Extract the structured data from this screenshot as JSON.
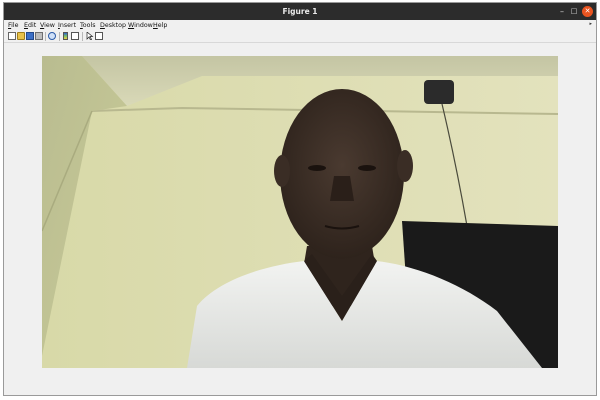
{
  "window": {
    "title": "Figure 1",
    "controls": {
      "minimize": "–",
      "maximize": "□",
      "close": "✕"
    }
  },
  "menubar": {
    "items": [
      "File",
      "Edit",
      "View",
      "Insert",
      "Tools",
      "Desktop",
      "Window",
      "Help"
    ],
    "overflow_arrow": "▸"
  },
  "toolbar": {
    "icons": [
      "new-figure-icon",
      "open-file-icon",
      "save-icon",
      "print-icon",
      "zoom-icon",
      "insert-colorbar-icon",
      "insert-legend-icon",
      "edit-plot-pointer-icon",
      "dock-figure-icon"
    ]
  },
  "figure": {
    "image_description_icon": "webcam-photo-person"
  }
}
